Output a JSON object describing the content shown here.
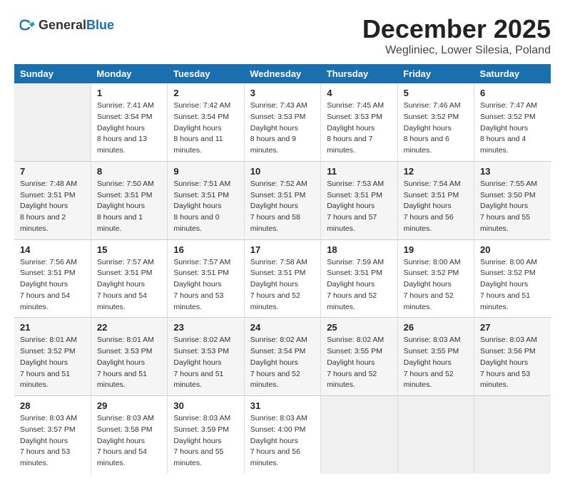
{
  "header": {
    "logo": {
      "general": "General",
      "blue": "Blue"
    },
    "month": "December 2025",
    "location": "Wegliniec, Lower Silesia, Poland"
  },
  "weekdays": [
    "Sunday",
    "Monday",
    "Tuesday",
    "Wednesday",
    "Thursday",
    "Friday",
    "Saturday"
  ],
  "weeks": [
    [
      null,
      {
        "day": 1,
        "sunrise": "7:41 AM",
        "sunset": "3:54 PM",
        "daylight": "8 hours and 13 minutes."
      },
      {
        "day": 2,
        "sunrise": "7:42 AM",
        "sunset": "3:54 PM",
        "daylight": "8 hours and 11 minutes."
      },
      {
        "day": 3,
        "sunrise": "7:43 AM",
        "sunset": "3:53 PM",
        "daylight": "8 hours and 9 minutes."
      },
      {
        "day": 4,
        "sunrise": "7:45 AM",
        "sunset": "3:53 PM",
        "daylight": "8 hours and 7 minutes."
      },
      {
        "day": 5,
        "sunrise": "7:46 AM",
        "sunset": "3:52 PM",
        "daylight": "8 hours and 6 minutes."
      },
      {
        "day": 6,
        "sunrise": "7:47 AM",
        "sunset": "3:52 PM",
        "daylight": "8 hours and 4 minutes."
      }
    ],
    [
      {
        "day": 7,
        "sunrise": "7:48 AM",
        "sunset": "3:51 PM",
        "daylight": "8 hours and 2 minutes."
      },
      {
        "day": 8,
        "sunrise": "7:50 AM",
        "sunset": "3:51 PM",
        "daylight": "8 hours and 1 minute."
      },
      {
        "day": 9,
        "sunrise": "7:51 AM",
        "sunset": "3:51 PM",
        "daylight": "8 hours and 0 minutes."
      },
      {
        "day": 10,
        "sunrise": "7:52 AM",
        "sunset": "3:51 PM",
        "daylight": "7 hours and 58 minutes."
      },
      {
        "day": 11,
        "sunrise": "7:53 AM",
        "sunset": "3:51 PM",
        "daylight": "7 hours and 57 minutes."
      },
      {
        "day": 12,
        "sunrise": "7:54 AM",
        "sunset": "3:51 PM",
        "daylight": "7 hours and 56 minutes."
      },
      {
        "day": 13,
        "sunrise": "7:55 AM",
        "sunset": "3:50 PM",
        "daylight": "7 hours and 55 minutes."
      }
    ],
    [
      {
        "day": 14,
        "sunrise": "7:56 AM",
        "sunset": "3:51 PM",
        "daylight": "7 hours and 54 minutes."
      },
      {
        "day": 15,
        "sunrise": "7:57 AM",
        "sunset": "3:51 PM",
        "daylight": "7 hours and 54 minutes."
      },
      {
        "day": 16,
        "sunrise": "7:57 AM",
        "sunset": "3:51 PM",
        "daylight": "7 hours and 53 minutes."
      },
      {
        "day": 17,
        "sunrise": "7:58 AM",
        "sunset": "3:51 PM",
        "daylight": "7 hours and 52 minutes."
      },
      {
        "day": 18,
        "sunrise": "7:59 AM",
        "sunset": "3:51 PM",
        "daylight": "7 hours and 52 minutes."
      },
      {
        "day": 19,
        "sunrise": "8:00 AM",
        "sunset": "3:52 PM",
        "daylight": "7 hours and 52 minutes."
      },
      {
        "day": 20,
        "sunrise": "8:00 AM",
        "sunset": "3:52 PM",
        "daylight": "7 hours and 51 minutes."
      }
    ],
    [
      {
        "day": 21,
        "sunrise": "8:01 AM",
        "sunset": "3:52 PM",
        "daylight": "7 hours and 51 minutes."
      },
      {
        "day": 22,
        "sunrise": "8:01 AM",
        "sunset": "3:53 PM",
        "daylight": "7 hours and 51 minutes."
      },
      {
        "day": 23,
        "sunrise": "8:02 AM",
        "sunset": "3:53 PM",
        "daylight": "7 hours and 51 minutes."
      },
      {
        "day": 24,
        "sunrise": "8:02 AM",
        "sunset": "3:54 PM",
        "daylight": "7 hours and 52 minutes."
      },
      {
        "day": 25,
        "sunrise": "8:02 AM",
        "sunset": "3:55 PM",
        "daylight": "7 hours and 52 minutes."
      },
      {
        "day": 26,
        "sunrise": "8:03 AM",
        "sunset": "3:55 PM",
        "daylight": "7 hours and 52 minutes."
      },
      {
        "day": 27,
        "sunrise": "8:03 AM",
        "sunset": "3:56 PM",
        "daylight": "7 hours and 53 minutes."
      }
    ],
    [
      {
        "day": 28,
        "sunrise": "8:03 AM",
        "sunset": "3:57 PM",
        "daylight": "7 hours and 53 minutes."
      },
      {
        "day": 29,
        "sunrise": "8:03 AM",
        "sunset": "3:58 PM",
        "daylight": "7 hours and 54 minutes."
      },
      {
        "day": 30,
        "sunrise": "8:03 AM",
        "sunset": "3:59 PM",
        "daylight": "7 hours and 55 minutes."
      },
      {
        "day": 31,
        "sunrise": "8:03 AM",
        "sunset": "4:00 PM",
        "daylight": "7 hours and 56 minutes."
      },
      null,
      null,
      null
    ]
  ]
}
